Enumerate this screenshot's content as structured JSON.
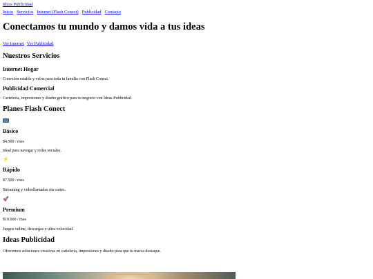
{
  "header": {
    "brand": "Ideas Publicidad",
    "nav": [
      "Inicio",
      "Servicios",
      "Internet (Flash Conect)",
      "Publicidad",
      "Contacto"
    ]
  },
  "hero": {
    "title": "Conectamos tu mundo y damos vida a tus ideas",
    "link_internet": "Ver Internet",
    "link_publicidad": "Ver Publicidad"
  },
  "services": {
    "heading": "Nuestros Servicios",
    "items": [
      {
        "title": "Internet Hogar",
        "desc": "Conexión estable y veloz para toda tu familia con Flash Conect."
      },
      {
        "title": "Publicidad Comercial",
        "desc": "Cartelería, impresiones y diseño gráfico para tu negocio con Ideas Publicidad."
      }
    ]
  },
  "plans": {
    "heading": "Planes Flash Conect",
    "items": [
      {
        "icon": "laptop-icon",
        "glyph": "",
        "name": "Básico",
        "price": "$4.500 / mes",
        "desc": "Ideal para navegar y redes sociales."
      },
      {
        "icon": "lightning-icon",
        "glyph": "⚡",
        "name": "Rápido",
        "price": "$7.500 / mes",
        "desc": "Streaming y videollamadas sin cortes."
      },
      {
        "icon": "rocket-icon",
        "glyph": "🚀",
        "name": "Premium",
        "price": "$10.000 / mes",
        "desc": "Juegos online, descargas y ultra velocidad."
      }
    ]
  },
  "publicidad": {
    "heading": "Ideas Publicidad",
    "desc": "Ofrecemos soluciones creativas en cartelería, impresiones y diseño para que tu marca destaque."
  }
}
